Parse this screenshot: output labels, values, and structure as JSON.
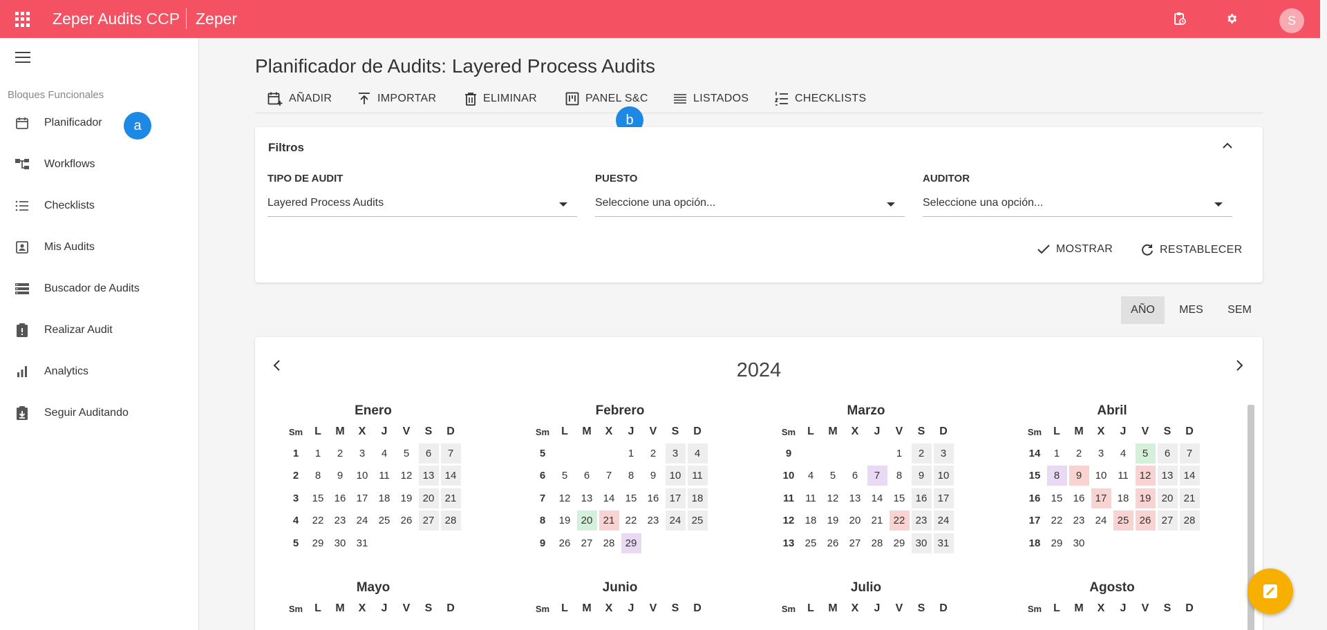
{
  "topbar": {
    "app_name": "Zeper Audits",
    "app_suffix": "CCP",
    "org": "Zeper",
    "avatar_initial": "S"
  },
  "sidebar": {
    "section": "Bloques Funcionales",
    "items": [
      {
        "label": "Planificador",
        "icon": "calendar-icon"
      },
      {
        "label": "Workflows",
        "icon": "workflow-icon"
      },
      {
        "label": "Checklists",
        "icon": "checklist-icon"
      },
      {
        "label": "Mis Audits",
        "icon": "account-box-icon"
      },
      {
        "label": "Buscador de Audits",
        "icon": "storage-icon"
      },
      {
        "label": "Realizar Audit",
        "icon": "clipboard-alert-icon"
      },
      {
        "label": "Analytics",
        "icon": "bar-chart-icon"
      },
      {
        "label": "Seguir Auditando",
        "icon": "clipboard-download-icon"
      }
    ]
  },
  "badges": {
    "a": "a",
    "b": "b"
  },
  "page": {
    "title": "Planificador de Audits: Layered Process Audits"
  },
  "toolbar": {
    "add": "AÑADIR",
    "import": "IMPORTAR",
    "delete": "ELIMINAR",
    "panel": "PANEL S&C",
    "lists": "LISTADOS",
    "checklists": "CHECKLISTS"
  },
  "filters": {
    "title": "Filtros",
    "tipo_label": "TIPO DE AUDIT",
    "tipo_value": "Layered Process Audits",
    "puesto_label": "PUESTO",
    "puesto_value": "Seleccione una opción...",
    "auditor_label": "AUDITOR",
    "auditor_value": "Seleccione una opción...",
    "show": "MOSTRAR",
    "reset": "RESTABLECER"
  },
  "views": {
    "year": "AÑO",
    "month": "MES",
    "week": "SEM",
    "active": "year"
  },
  "calendar": {
    "year": "2024",
    "headers": [
      "Sm",
      "L",
      "M",
      "X",
      "J",
      "V",
      "S",
      "D"
    ],
    "months": [
      {
        "name": "Enero",
        "weeks": [
          {
            "wk": "1",
            "days": [
              "1",
              "2",
              "3",
              "4",
              "5",
              "6",
              "7"
            ]
          },
          {
            "wk": "2",
            "days": [
              "8",
              "9",
              "10",
              "11",
              "12",
              "13",
              "14"
            ]
          },
          {
            "wk": "3",
            "days": [
              "15",
              "16",
              "17",
              "18",
              "19",
              "20",
              "21"
            ]
          },
          {
            "wk": "4",
            "days": [
              "22",
              "23",
              "24",
              "25",
              "26",
              "27",
              "28"
            ]
          },
          {
            "wk": "5",
            "days": [
              "29",
              "30",
              "31",
              "",
              "",
              "",
              ""
            ]
          }
        ],
        "highlights": {}
      },
      {
        "name": "Febrero",
        "weeks": [
          {
            "wk": "5",
            "days": [
              "",
              "",
              "",
              "1",
              "2",
              "3",
              "4"
            ]
          },
          {
            "wk": "6",
            "days": [
              "5",
              "6",
              "7",
              "8",
              "9",
              "10",
              "11"
            ]
          },
          {
            "wk": "7",
            "days": [
              "12",
              "13",
              "14",
              "15",
              "16",
              "17",
              "18"
            ]
          },
          {
            "wk": "8",
            "days": [
              "19",
              "20",
              "21",
              "22",
              "23",
              "24",
              "25"
            ]
          },
          {
            "wk": "9",
            "days": [
              "26",
              "27",
              "28",
              "29",
              "",
              "",
              ""
            ]
          }
        ],
        "highlights": {
          "20": "green",
          "21": "red",
          "29": "purple"
        }
      },
      {
        "name": "Marzo",
        "weeks": [
          {
            "wk": "9",
            "days": [
              "",
              "",
              "",
              "",
              "1",
              "2",
              "3"
            ]
          },
          {
            "wk": "10",
            "days": [
              "4",
              "5",
              "6",
              "7",
              "8",
              "9",
              "10"
            ]
          },
          {
            "wk": "11",
            "days": [
              "11",
              "12",
              "13",
              "14",
              "15",
              "16",
              "17"
            ]
          },
          {
            "wk": "12",
            "days": [
              "18",
              "19",
              "20",
              "21",
              "22",
              "23",
              "24"
            ]
          },
          {
            "wk": "13",
            "days": [
              "25",
              "26",
              "27",
              "28",
              "29",
              "30",
              "31"
            ]
          }
        ],
        "highlights": {
          "7": "purple",
          "22": "red"
        }
      },
      {
        "name": "Abril",
        "weeks": [
          {
            "wk": "14",
            "days": [
              "1",
              "2",
              "3",
              "4",
              "5",
              "6",
              "7"
            ]
          },
          {
            "wk": "15",
            "days": [
              "8",
              "9",
              "10",
              "11",
              "12",
              "13",
              "14"
            ]
          },
          {
            "wk": "16",
            "days": [
              "15",
              "16",
              "17",
              "18",
              "19",
              "20",
              "21"
            ]
          },
          {
            "wk": "17",
            "days": [
              "22",
              "23",
              "24",
              "25",
              "26",
              "27",
              "28"
            ]
          },
          {
            "wk": "18",
            "days": [
              "29",
              "30",
              "",
              "",
              "",
              "",
              ""
            ]
          }
        ],
        "highlights": {
          "5": "green",
          "8": "purple",
          "9": "red",
          "12": "red",
          "17": "red",
          "19": "red",
          "25": "red",
          "26": "red"
        }
      },
      {
        "name": "Mayo",
        "weeks": [],
        "highlights": {}
      },
      {
        "name": "Junio",
        "weeks": [],
        "highlights": {}
      },
      {
        "name": "Julio",
        "weeks": [],
        "highlights": {}
      },
      {
        "name": "Agosto",
        "weeks": [],
        "highlights": {}
      }
    ]
  },
  "colors": {
    "brand": "#f45162",
    "badge": "#1e88e5",
    "fab": "#f7b000"
  }
}
